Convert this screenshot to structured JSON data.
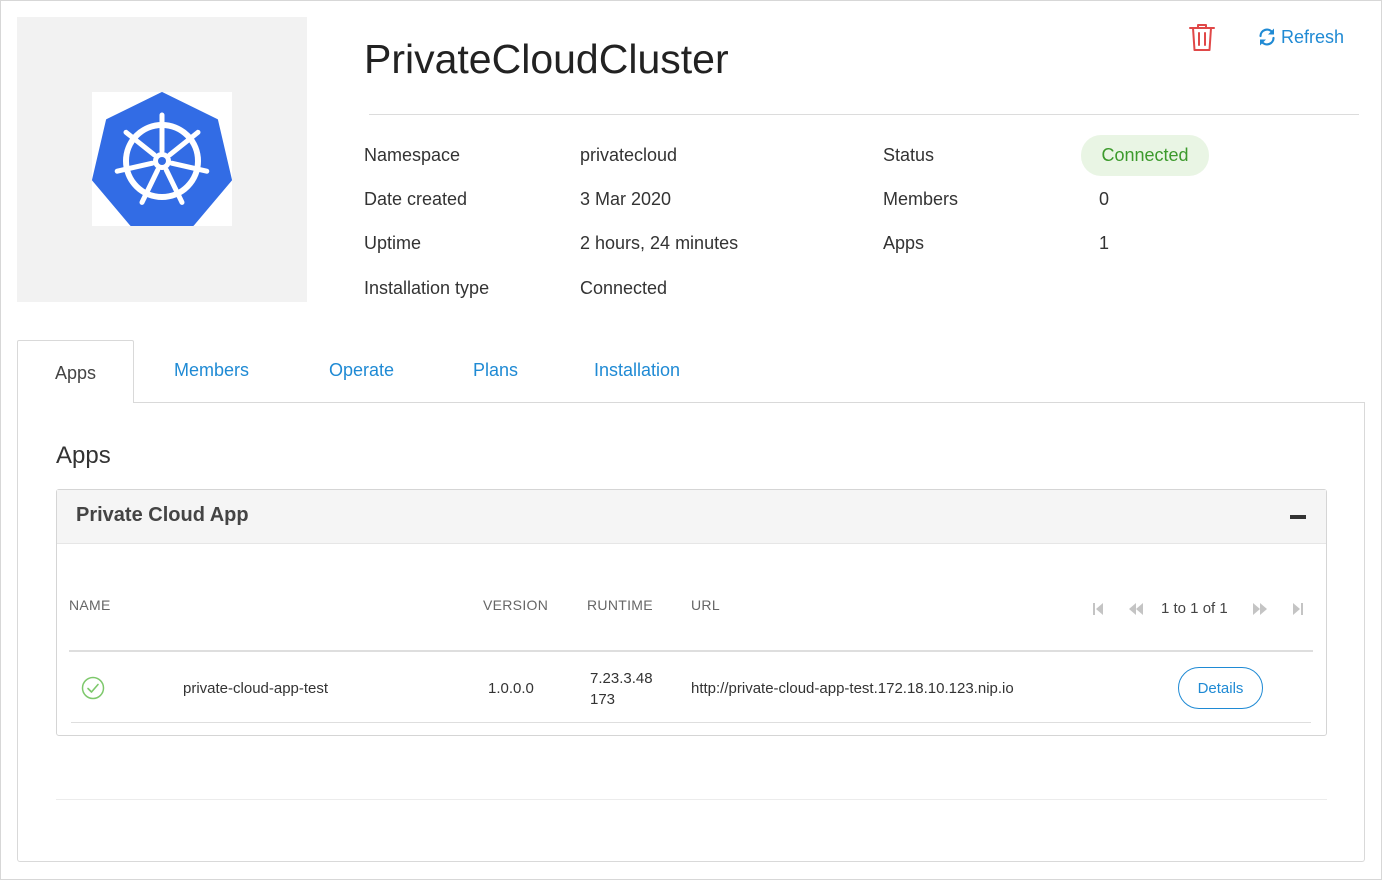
{
  "header": {
    "title": "PrivateCloudCluster",
    "refresh_label": "Refresh",
    "delete_icon": "trash-icon",
    "refresh_icon": "refresh-icon",
    "logo_icon": "kubernetes-logo"
  },
  "details": {
    "namespace_label": "Namespace",
    "namespace_value": "privatecloud",
    "date_label": "Date created",
    "date_value": "3 Mar 2020",
    "uptime_label": "Uptime",
    "uptime_value": "2 hours, 24 minutes",
    "install_label": "Installation type",
    "install_value": "Connected",
    "status_label": "Status",
    "status_value": "Connected",
    "members_label": "Members",
    "members_value": "0",
    "apps_label": "Apps",
    "apps_value": "1"
  },
  "tabs": [
    {
      "label": "Apps",
      "active": true
    },
    {
      "label": "Members",
      "active": false
    },
    {
      "label": "Operate",
      "active": false
    },
    {
      "label": "Plans",
      "active": false
    },
    {
      "label": "Installation",
      "active": false
    }
  ],
  "apps_section": {
    "title": "Apps",
    "card_title": "Private Cloud App",
    "columns": {
      "name": "NAME",
      "version": "VERSION",
      "runtime": "RUNTIME",
      "url": "URL"
    },
    "pager": "1 to 1 of 1",
    "rows": [
      {
        "status_icon": "check-circle-icon",
        "name": "private-cloud-app-test",
        "version": "1.0.0.0",
        "runtime_line1": "7.23.3.48",
        "runtime_line2": "173",
        "url": "http://private-cloud-app-test.172.18.10.123.nip.io",
        "details_label": "Details"
      }
    ]
  },
  "colors": {
    "accent": "#1f8ad4",
    "status_green": "#3c9a2c",
    "status_bg": "#e9f5e4",
    "delete_red": "#e04848",
    "kubernetes_blue": "#326ce5"
  }
}
